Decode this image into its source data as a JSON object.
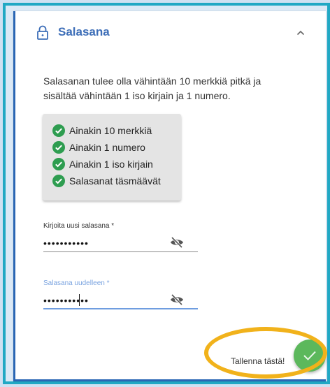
{
  "section": {
    "title": "Salasana",
    "icons": {
      "lock": "lock-icon",
      "toggle": "chevron-up-icon"
    }
  },
  "description": "Salasanan tulee olla vähintään 10 merkkiä pitkä ja sisältää vähintään 1 iso kirjain ja 1 numero.",
  "requirements": [
    {
      "label": "Ainakin 10 merkkiä",
      "met": true
    },
    {
      "label": "Ainakin 1 numero",
      "met": true
    },
    {
      "label": "Ainakin 1 iso kirjain",
      "met": true
    },
    {
      "label": "Salasanat täsmäävät",
      "met": true
    }
  ],
  "fields": {
    "new_password": {
      "label": "Kirjoita uusi salasana *",
      "value": "•••••••••••",
      "icon": "eye-off-icon"
    },
    "confirm_password": {
      "label": "Salasana uudelleen *",
      "value": "•••••••••••",
      "icon": "eye-off-icon"
    }
  },
  "save": {
    "label": "Tallenna tästä!",
    "icon": "check-icon"
  },
  "colors": {
    "accent": "#3d6eb8",
    "success": "#5cb85c",
    "frame": "#21a8c4",
    "highlight": "#f1b21b"
  }
}
